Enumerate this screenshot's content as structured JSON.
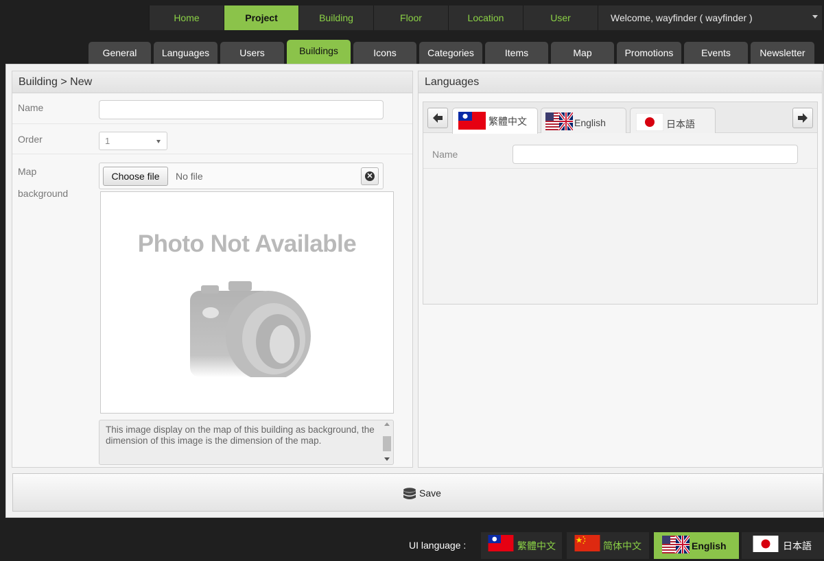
{
  "topnav": {
    "items": [
      "Home",
      "Project",
      "Building",
      "Floor",
      "Location",
      "User"
    ],
    "active_index": 1,
    "welcome": "Welcome, wayfinder ( wayfinder )"
  },
  "subtabs": {
    "items": [
      "General",
      "Languages",
      "Users",
      "Buildings",
      "Icons",
      "Categories",
      "Items",
      "Map",
      "Promotions",
      "Events",
      "Newsletter"
    ],
    "active_index": 3
  },
  "building_form": {
    "header": "Building > New",
    "name_label": "Name",
    "name_value": "",
    "order_label": "Order",
    "order_value": "1",
    "map_label": "Map",
    "background_label": "background",
    "choose_file_label": "Choose file",
    "no_file_text": "No file",
    "photo_placeholder": "Photo Not Available",
    "description": "This image display on the map of this building as background, the dimension of this image is the dimension of the map."
  },
  "languages_panel": {
    "header": "Languages",
    "tabs": [
      {
        "label": "繁體中文",
        "flag": "taiwan-flag"
      },
      {
        "label": "English",
        "flag": "uk-us-flag"
      },
      {
        "label": "日本語",
        "flag": "japan-flag"
      }
    ],
    "active_tab_index": 0,
    "name_label": "Name",
    "name_value": ""
  },
  "save_label": "Save",
  "footer": {
    "ui_language_label": "UI language :",
    "languages": [
      {
        "label": "繁體中文",
        "flag": "taiwan-flag"
      },
      {
        "label": "简体中文",
        "flag": "china-flag"
      },
      {
        "label": "English",
        "flag": "uk-us-flag"
      },
      {
        "label": "日本語",
        "flag": "japan-flag"
      }
    ],
    "active_index": 2
  },
  "colors": {
    "accent_green": "#8bc34a",
    "nav_text_green": "#8bd146",
    "dark_bg": "#1f1f1f"
  }
}
